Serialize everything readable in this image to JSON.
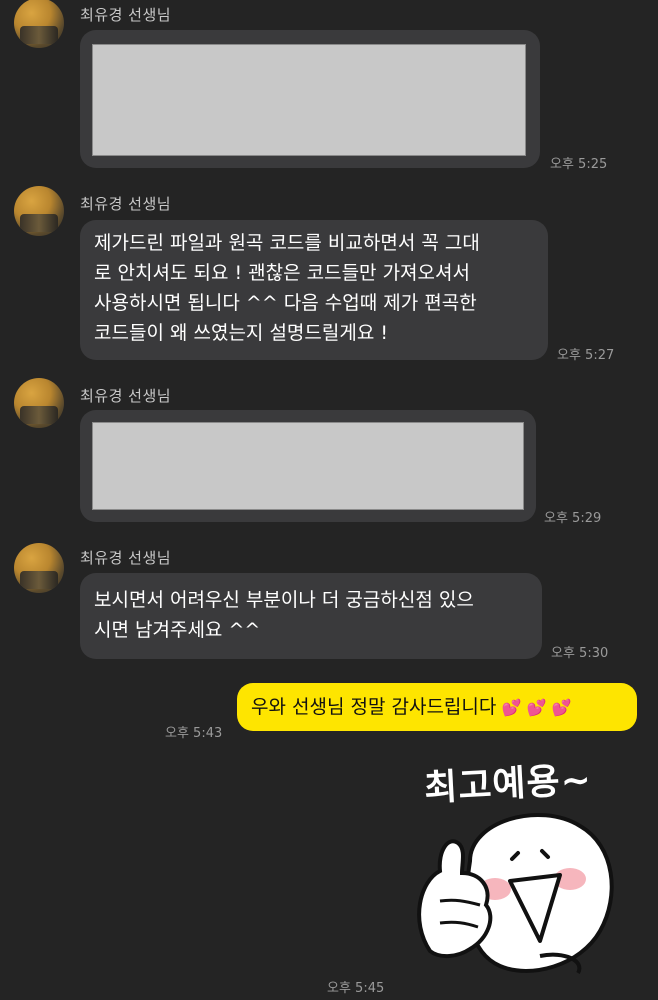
{
  "messages": [
    {
      "sender": "최유경 선생님",
      "time": "오후 5:25"
    },
    {
      "sender": "최유경 선생님",
      "text": "제가드린 파일과 원곡 코드를 비교하면서 꼭 그대\n로 안치셔도 되요 ! 괜찮은 코드들만 가져오셔서\n사용하시면 됩니다 ^^ 다음 수업때 제가 편곡한\n코드들이 왜 쓰였는지 설명드릴게요 !",
      "time": "오후 5:27"
    },
    {
      "sender": "최유경 선생님",
      "time": "오후 5:29"
    },
    {
      "sender": "최유경 선생님",
      "text": "보시면서 어려우신 부분이나 더 궁금하신점 있으\n시면 남겨주세요 ^^",
      "time": "오후 5:30"
    }
  ],
  "my_message": {
    "text": "우와 선생님 정말 감사드립니다",
    "time": "오후 5:43"
  },
  "sticker": {
    "caption": "최고예용~",
    "time": "오후 5:45"
  },
  "colors": {
    "background": "#242424",
    "bubble": "#3a3a3c",
    "my_bubble": "#fee500",
    "heart": "#ff4fa8"
  }
}
